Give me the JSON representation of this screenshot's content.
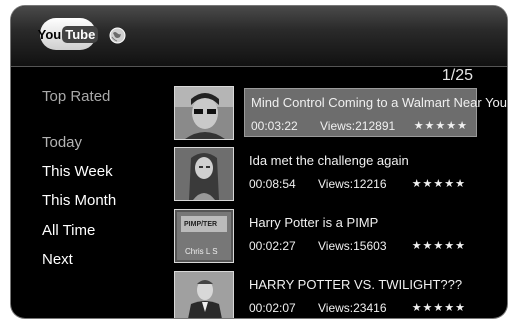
{
  "header": {
    "logo_you": "You",
    "logo_tube": "Tube",
    "icon": "globe-icon"
  },
  "page_indicator": "1/25",
  "menu": {
    "heading": "Top Rated",
    "items": [
      {
        "label": "Today",
        "dim": true
      },
      {
        "label": "This Week",
        "dim": false
      },
      {
        "label": "This Month",
        "dim": false
      },
      {
        "label": "All Time",
        "dim": false
      },
      {
        "label": "Next",
        "dim": false
      }
    ]
  },
  "videos": [
    {
      "title": "Mind Control Coming to a Walmart Near You!",
      "duration": "00:03:22",
      "views": "Views:212891",
      "stars": "★★★★★",
      "selected": true,
      "thumb": "man with glasses"
    },
    {
      "title": "Ida met the challenge again",
      "duration": "00:08:54",
      "views": "Views:12216",
      "stars": "★★★★★",
      "selected": false,
      "thumb": "girl with long hair"
    },
    {
      "title": "Harry Potter is a PIMP",
      "duration": "00:02:27",
      "views": "Views:15603",
      "stars": "★★★★★",
      "selected": false,
      "thumb": "title card"
    },
    {
      "title": "HARRY POTTER VS. TWILIGHT???",
      "duration": "00:02:07",
      "views": "Views:23416",
      "stars": "★★★★★",
      "selected": false,
      "thumb": "man in suit"
    }
  ],
  "thumb_texts": {
    "third_a": "PIMP/TER",
    "third_b": "Chris L S"
  }
}
